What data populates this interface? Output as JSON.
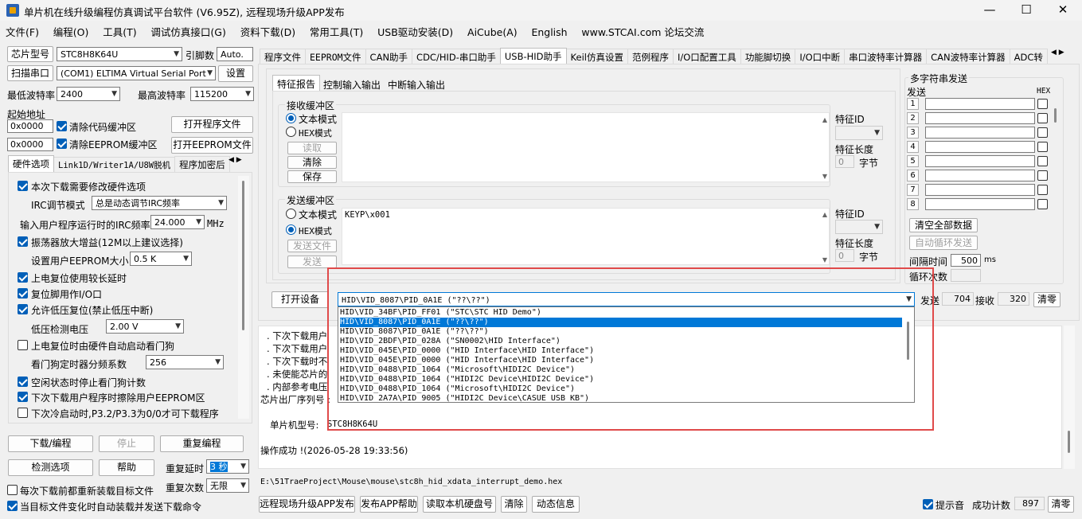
{
  "window": {
    "title": "单片机在线升级编程仿真调试平台软件 (V6.95Z), 远程现场升级APP发布",
    "min_label": "—",
    "max_label": "☐",
    "close_label": "✕"
  },
  "menu": [
    "文件(F)",
    "编程(O)",
    "工具(T)",
    "调试仿真接口(G)",
    "资料下载(D)",
    "常用工具(T)",
    "USB驱动安装(D)",
    "AiCube(A)",
    "English",
    "www.STCAI.com 论坛交流"
  ],
  "left": {
    "chip_type_label": "芯片型号",
    "chip_type_value": "STC8H8K64U",
    "pin_count_label": "引脚数",
    "pin_count_value": "Auto.",
    "scan_port_label": "扫描串口",
    "port_value": "(COM1) ELTIMA Virtual Serial Port",
    "settings_label": "设置",
    "min_baud_label": "最低波特率",
    "min_baud_value": "2400",
    "max_baud_label": "最高波特率",
    "max_baud_value": "115200",
    "start_addr_label": "起始地址",
    "code_addr": "0x0000",
    "clear_code_label": "清除代码缓冲区",
    "open_prog_label": "打开程序文件",
    "eeprom_addr": "0x0000",
    "clear_eeprom_label": "清除EEPROM缓冲区",
    "open_eeprom_label": "打开EEPROM文件",
    "tabs": [
      "硬件选项",
      "Link1D/Writer1A/U8W脱机",
      "程序加密后"
    ],
    "hw": {
      "modify_hw": "本次下载需要修改硬件选项",
      "irc_mode_label": "IRC调节模式",
      "irc_mode_value": "总是动态调节IRC频率",
      "irc_freq_label": "输入用户程序运行时的IRC频率",
      "irc_freq_value": "24.000",
      "irc_freq_unit": "MHz",
      "osc_gain": "振荡器放大增益(12M以上建议选择)",
      "eeprom_size_label": "设置用户EEPROM大小",
      "eeprom_size_value": "0.5 K",
      "por_delay": "上电复位使用较长延时",
      "reset_io": "复位脚用作I/O口",
      "lvd_reset": "允许低压复位(禁止低压中断)",
      "lvd_label": "低压检测电压",
      "lvd_value": "2.00 V",
      "wdt_por": "上电复位时由硬件自动启动看门狗",
      "wdt_div_label": "看门狗定时器分频系数",
      "wdt_div_value": "256",
      "idle_wdt": "空闲状态时停止看门狗计数",
      "erase_eeprom": "下次下载用户程序时擦除用户EEPROM区",
      "cold_boot": "下次冷启动时,P3.2/P3.3为0/0才可下载程序"
    },
    "download_label": "下载/编程",
    "stop_label": "停止",
    "reprogram_label": "重复编程",
    "detect_label": "检测选项",
    "help_label": "帮助",
    "repeat_delay_label": "重复延时",
    "repeat_delay_value": "3 秒",
    "repeat_count_label": "重复次数",
    "repeat_count_value": "无限",
    "reload_each": "每次下载前都重新装载目标文件",
    "auto_reload": "当目标文件变化时自动装载并发送下载命令"
  },
  "top_tabs": [
    "程序文件",
    "EEPROM文件",
    "CAN助手",
    "CDC/HID-串口助手",
    "USB-HID助手",
    "Keil仿真设置",
    "范例程序",
    "I/O口配置工具",
    "功能脚切换",
    "I/O口中断",
    "串口波特率计算器",
    "CAN波特率计算器",
    "ADC转"
  ],
  "hid": {
    "sub_tabs": [
      "特征报告",
      "控制输入输出",
      "中断输入输出"
    ],
    "recv_title": "接收缓冲区",
    "text_mode": "文本模式",
    "hex_mode": "HEX模式",
    "read_label": "读取",
    "clear_label": "清除",
    "save_label": "保存",
    "feature_id_label": "特征ID",
    "feature_len_label": "特征长度",
    "recv_len_value": "0",
    "bytes_unit": "字节",
    "send_title": "发送缓冲区",
    "send_file_label": "发送文件",
    "send_label": "发送",
    "send_content": "KEYP\\x001",
    "send_len_value": "0",
    "open_device_label": "打开设备",
    "device_selected": "HID\\VID_8087\\PID_0A1E (\"??\\??\")",
    "devices": [
      "HID\\VID_34BF\\PID_FF01 (\"STC\\STC HID Demo\")",
      "HID\\VID_8087\\PID_0A1E (\"??\\??\")",
      "HID\\VID_8087\\PID_0A1E (\"??\\??\")",
      "HID\\VID_2BDF\\PID_028A (\"SN0002\\HID Interface\")",
      "HID\\VID_045E\\PID_0000 (\"HID Interface\\HID Interface\")",
      "HID\\VID_045E\\PID_0000 (\"HID Interface\\HID Interface\")",
      "HID\\VID_0488\\PID_1064 (\"Microsoft\\HIDI2C Device\")",
      "HID\\VID_0488\\PID_1064 (\"HIDI2C Device\\HIDI2C Device\")",
      "HID\\VID_0488\\PID_1064 (\"Microsoft\\HIDI2C Device\")",
      "HID\\VID_2A7A\\PID_9005 (\"HIDI2C Device\\CASUE USB KB\")"
    ],
    "send_count_label": "发送",
    "send_count_value": "704",
    "recv_count_label": "接收",
    "recv_count_value": "320",
    "reset_count_label": "清零"
  },
  "multi": {
    "title": "多字符串发送",
    "send_header": "发送",
    "hex_header": "HEX",
    "rows": [
      "1",
      "2",
      "3",
      "4",
      "5",
      "6",
      "7",
      "8"
    ],
    "clear_all_label": "清空全部数据",
    "auto_loop_label": "自动循环发送",
    "interval_label": "间隔时间",
    "interval_value": "500",
    "interval_unit": "ms",
    "loop_count_label": "循环次数"
  },
  "log": {
    "lines": [
      ". 下次下载用户",
      ". 下次下载用户",
      ". 下次下载时不",
      ". 未使能芯片的",
      ". 内部参考电压"
    ],
    "serial_label": "芯片出厂序列号 :",
    "chip_label": "单片机型号:",
    "chip_value": "STC8H8K64U",
    "success": "操作成功 !(2026-05-28 19:33:56)"
  },
  "file_path": "E:\\51TraeProject\\Mouse\\mouse\\stc8h_hid_xdata_interrupt_demo.hex",
  "bottom": {
    "remote_upgrade_label": "远程现场升级APP发布",
    "publish_help_label": "发布APP帮助",
    "read_disk_label": "读取本机硬盘号",
    "clear_label": "清除",
    "animation_label": "动态信息",
    "prompt_sound_label": "提示音",
    "success_count_label": "成功计数",
    "success_count_value": "897",
    "reset_label": "清零"
  }
}
